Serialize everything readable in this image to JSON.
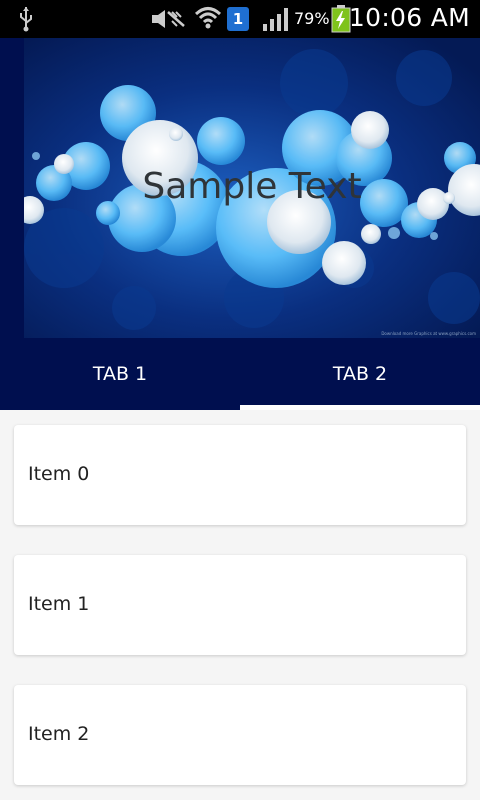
{
  "status_bar": {
    "battery_percent": "79%",
    "time": "10:06 AM",
    "notification_badge": "1",
    "icons": [
      "usb-icon",
      "mute-icon",
      "wifi-icon",
      "notification-icon",
      "signal-icon",
      "battery-charging-icon"
    ]
  },
  "header": {
    "title": "Sample Text",
    "image_credit": "Download more Graphics at www.graphics.com"
  },
  "tabs": [
    {
      "label": "TAB 1",
      "selected": false
    },
    {
      "label": "TAB 2",
      "selected": true
    }
  ],
  "list": {
    "items": [
      {
        "label": "Item 0"
      },
      {
        "label": "Item 1"
      },
      {
        "label": "Item 2"
      }
    ]
  },
  "colors": {
    "header_background": "#000f4f",
    "status_bar_background": "#000000",
    "tab_indicator": "#ffffff",
    "page_background": "#f5f5f5"
  }
}
